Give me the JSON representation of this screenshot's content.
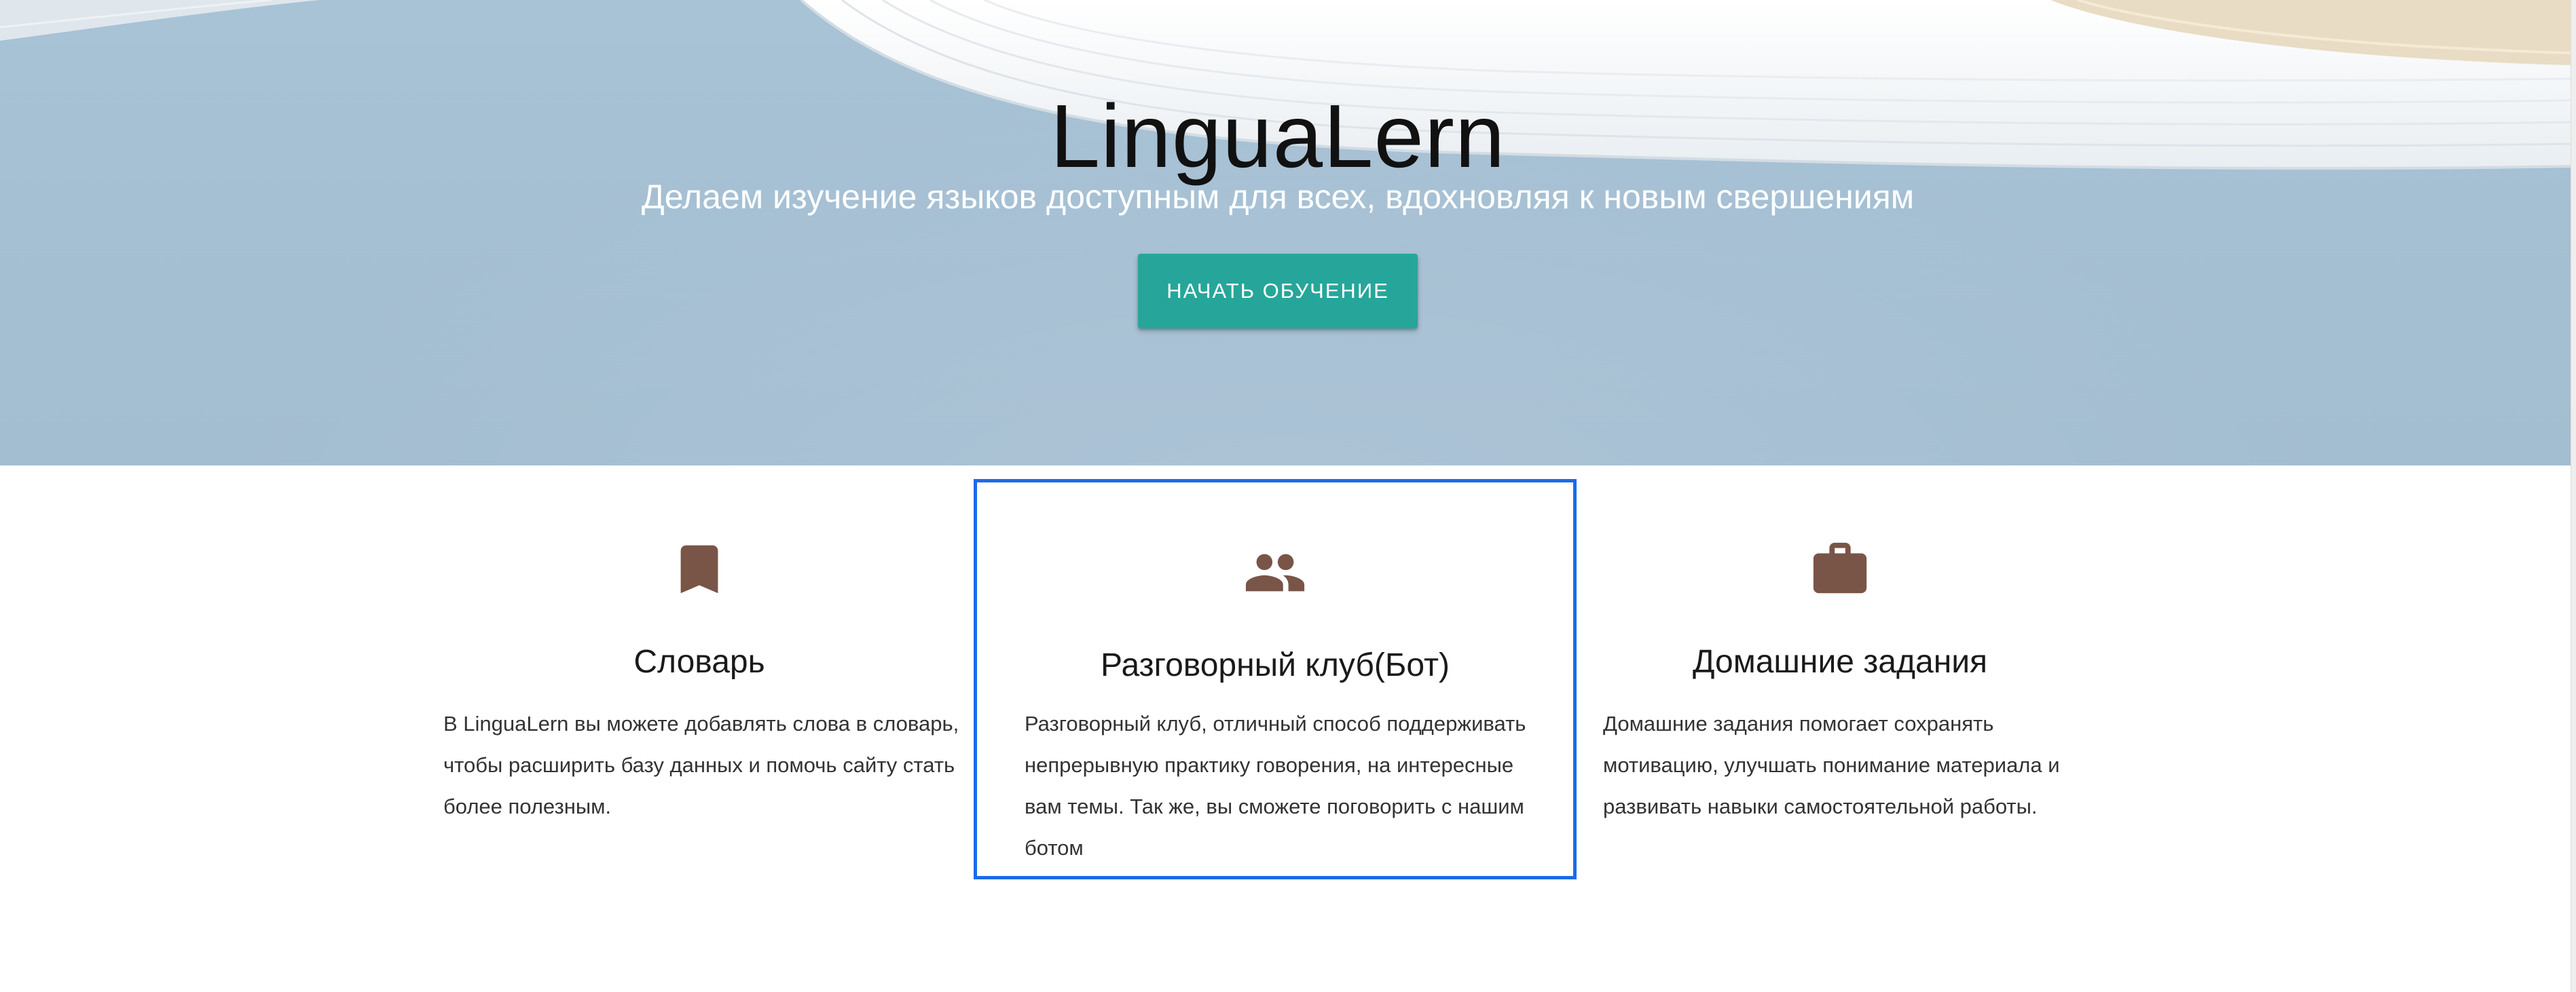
{
  "hero": {
    "title": "LinguaLern",
    "subtitle": "Делаем изучение языков доступным для всех, вдохновляя к новым свершениям",
    "cta_label": "НАЧАТЬ ОБУЧЕНИЕ"
  },
  "features": [
    {
      "icon": "bookmark-icon",
      "title": "Словарь",
      "text": "В LinguaLern вы можете добавлять слова в словарь, чтобы расширить базу данных и помочь сайту стать более полезным."
    },
    {
      "icon": "group-icon",
      "title": "Разговорный клуб(Бот)",
      "text": "Разговорный клуб, отличный способ поддерживать непрерывную практику говорения, на интересные вам темы. Так же, вы сможете поговорить с нашим ботом"
    },
    {
      "icon": "briefcase-icon",
      "title": "Домашние задания",
      "text": "Домашние задания помогает сохранять мотивацию, улучшать понимание материала и развивать навыки самостоятельной работы."
    }
  ],
  "colors": {
    "accent": "#26a69a",
    "icon": "#795548",
    "highlight_border": "#1a6ce6",
    "hero_background": "#a7c1d5"
  }
}
